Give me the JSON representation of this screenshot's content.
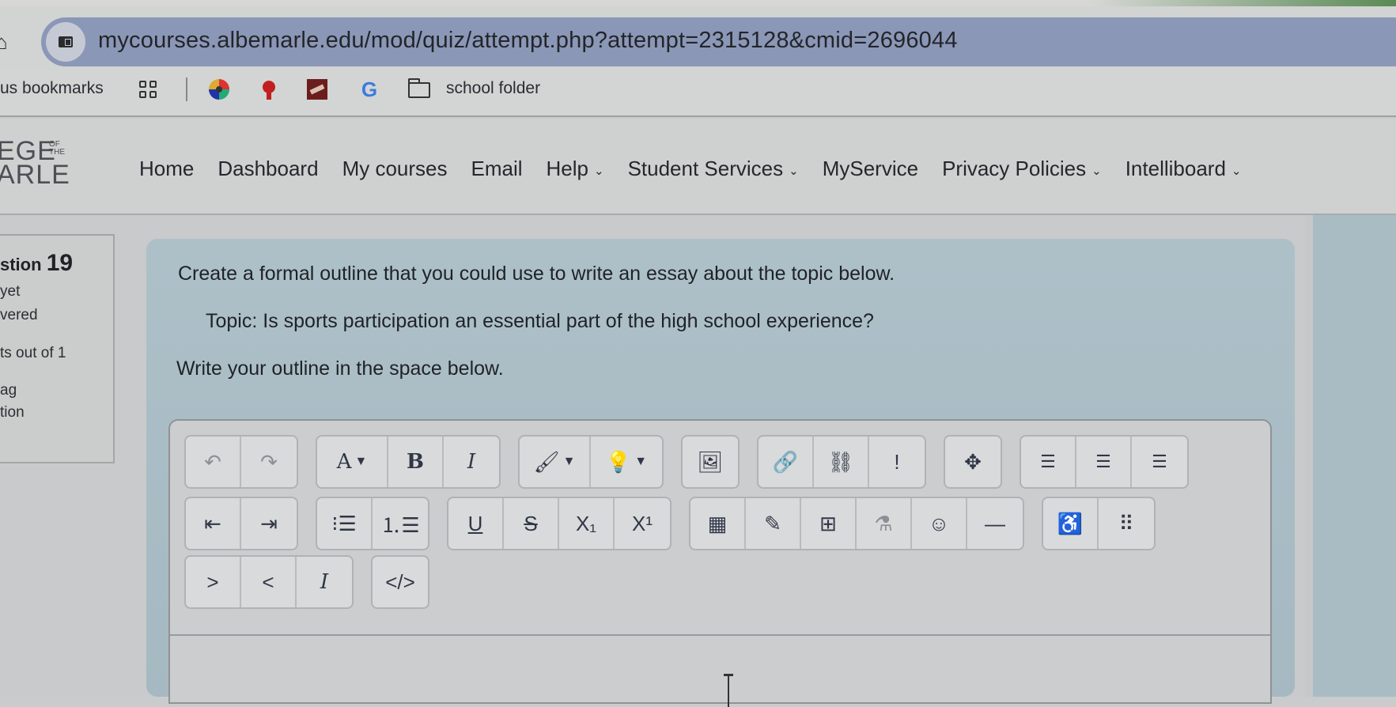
{
  "browser": {
    "url": "mycourses.albemarle.edu/mod/quiz/attempt.php?attempt=2315128&cmid=2696044",
    "bookmarks_label": "us bookmarks",
    "bookmarks": [
      {
        "icon": "apps-grid-icon"
      },
      {
        "icon": "colorful-circle-favicon"
      },
      {
        "icon": "red-mascot-favicon"
      },
      {
        "icon": "maroon-map-favicon"
      },
      {
        "icon": "google-favicon",
        "glyph": "G"
      },
      {
        "icon": "folder-icon",
        "label": "school folder"
      }
    ]
  },
  "site": {
    "logo_line1": "EGE",
    "logo_small": "OF THE",
    "logo_line2": "ARLE",
    "nav": [
      {
        "label": "Home",
        "dropdown": false
      },
      {
        "label": "Dashboard",
        "dropdown": false
      },
      {
        "label": "My courses",
        "dropdown": false
      },
      {
        "label": "Email",
        "dropdown": false
      },
      {
        "label": "Help",
        "dropdown": true
      },
      {
        "label": "Student Services",
        "dropdown": true
      },
      {
        "label": "MyService",
        "dropdown": false
      },
      {
        "label": "Privacy Policies",
        "dropdown": true
      },
      {
        "label": "Intelliboard",
        "dropdown": true
      }
    ],
    "chevron": "⌄"
  },
  "question_info": {
    "question_prefix": "stion",
    "question_number": "19",
    "status_line1": "yet",
    "status_line2": "vered",
    "marks": "ts out of 1",
    "flag": "ag",
    "edit": "tion"
  },
  "question": {
    "prompt": "Create a formal outline that you could use to write an essay about the topic below.",
    "topic": "Topic: Is sports participation an essential part of the high school experience?",
    "instruction": "Write your outline in the space below."
  },
  "editor": {
    "row1": [
      [
        {
          "name": "undo-button",
          "glyph": "↶"
        },
        {
          "name": "redo-button",
          "glyph": "↷"
        }
      ],
      [
        {
          "name": "font-style-button",
          "glyph": "A",
          "dropdown": true
        },
        {
          "name": "bold-button",
          "glyph": "B"
        },
        {
          "name": "italic-button",
          "glyph": "I"
        }
      ],
      [
        {
          "name": "font-color-button",
          "glyph": "🖌",
          "dropdown": true
        },
        {
          "name": "background-color-button",
          "glyph": "💡",
          "dropdown": true
        }
      ],
      [
        {
          "name": "insert-image-button",
          "glyph": "🖼"
        }
      ],
      [
        {
          "name": "link-button",
          "glyph": "🔗"
        },
        {
          "name": "unlink-button",
          "glyph": "⛓"
        },
        {
          "name": "accessibility-warning-button",
          "glyph": "!"
        }
      ],
      [
        {
          "name": "fullscreen-button",
          "glyph": "✥"
        }
      ],
      [
        {
          "name": "align-left-button",
          "glyph": "☰"
        },
        {
          "name": "align-center-button",
          "glyph": "☰"
        },
        {
          "name": "align-right-button",
          "glyph": "☰"
        }
      ]
    ],
    "row2": [
      [
        {
          "name": "outdent-button",
          "glyph": "⇤"
        },
        {
          "name": "indent-button",
          "glyph": "⇥"
        }
      ],
      [
        {
          "name": "bullet-list-button",
          "glyph": "⁝☰"
        },
        {
          "name": "numbered-list-button",
          "glyph": "⒈☰"
        }
      ],
      [
        {
          "name": "underline-button",
          "glyph": "U"
        },
        {
          "name": "strikethrough-button",
          "glyph": "S"
        },
        {
          "name": "subscript-button",
          "glyph": "X₁"
        },
        {
          "name": "superscript-button",
          "glyph": "X¹"
        }
      ],
      [
        {
          "name": "equation-button",
          "glyph": "▦"
        },
        {
          "name": "edit-button",
          "glyph": "✎"
        },
        {
          "name": "table-button",
          "glyph": "⊞"
        },
        {
          "name": "chemistry-button",
          "glyph": "⚗"
        },
        {
          "name": "emoji-button",
          "glyph": "☺"
        },
        {
          "name": "horizontal-rule-button",
          "glyph": "—"
        }
      ],
      [
        {
          "name": "accessibility-checker-button",
          "glyph": "♿"
        },
        {
          "name": "more-buttons",
          "glyph": "⠿"
        }
      ]
    ],
    "row3": [
      [
        {
          "name": "ltr-button",
          "glyph": ">"
        },
        {
          "name": "rtl-button",
          "glyph": "<"
        },
        {
          "name": "clear-formatting-button",
          "glyph": "I"
        }
      ],
      [
        {
          "name": "html-source-button",
          "glyph": "</>"
        }
      ]
    ],
    "content": ""
  }
}
